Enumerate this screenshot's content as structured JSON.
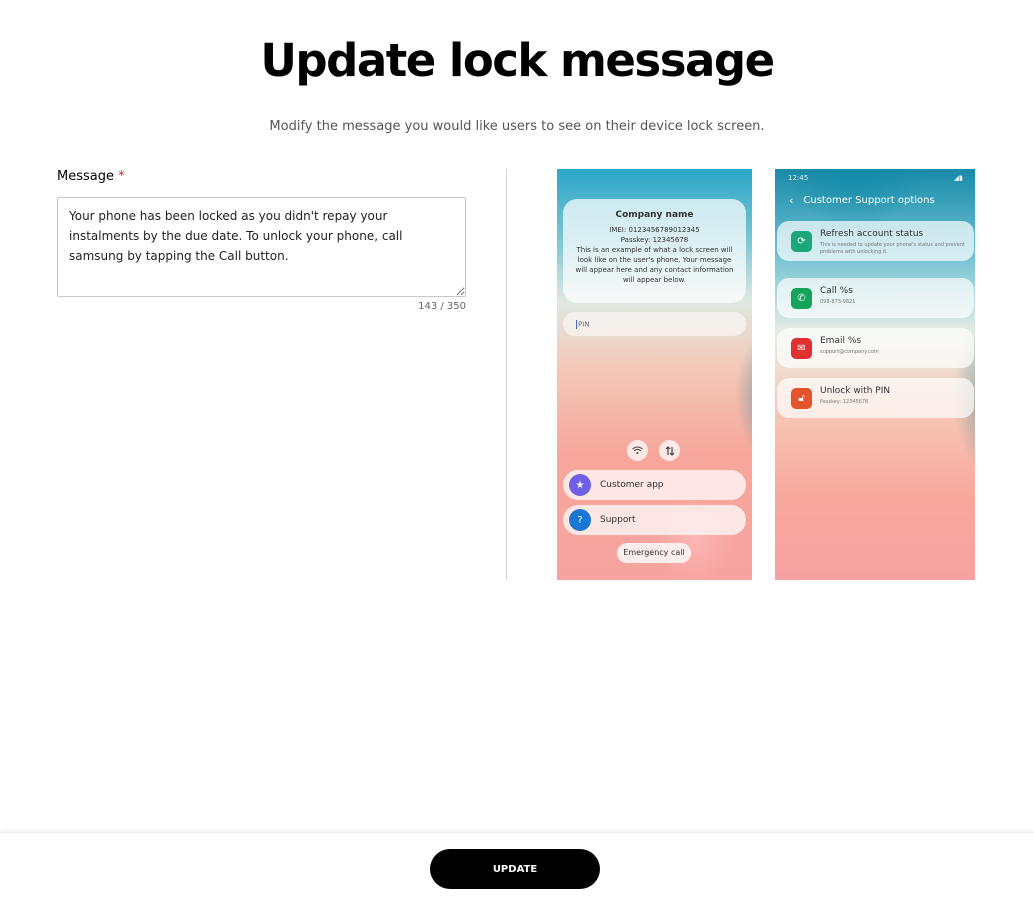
{
  "header": {
    "title": "Update lock message",
    "subtitle": "Modify the message you would like users to see on their device lock screen."
  },
  "form": {
    "label": "Message",
    "required_mark": "*",
    "value": "Your phone has been locked as you didn't repay your instalments by the due date. To unlock your phone, call samsung by tapping the Call button.",
    "char_count": "143 / 350"
  },
  "preview_lock": {
    "company": "Company name",
    "imei": "IMEI: 0123456789012345",
    "passkey": "Passkey: 12345678",
    "body": "This is an example of what a lock screen will look like on the user's phone. Your message will appear here and any contact information will appear below.",
    "pin_placeholder": "PIN",
    "apps": [
      {
        "label": "Customer app",
        "icon": "star-icon",
        "color": "#6e5fe6"
      },
      {
        "label": "Support",
        "icon": "question-icon",
        "color": "#1877d4"
      }
    ],
    "emergency": "Emergency call"
  },
  "preview_support": {
    "time": "12:45",
    "title": "Customer Support options",
    "options": [
      {
        "title": "Refresh account status",
        "sub": "This is needed to update your phone's status and prevent problems with unlocking it.",
        "icon": "refresh-icon",
        "color": "#1aa77a"
      },
      {
        "title": "Call %s",
        "sub": "098-873-9821",
        "icon": "phone-icon",
        "color": "#14a35a"
      },
      {
        "title": "Email %s",
        "sub": "support@company.com",
        "icon": "mail-icon",
        "color": "#e23030"
      },
      {
        "title": "Unlock with PIN",
        "sub": "Passkey: 12345678",
        "icon": "unlock-icon",
        "color": "#e5532d"
      }
    ]
  },
  "footer": {
    "update_label": "UPDATE"
  }
}
